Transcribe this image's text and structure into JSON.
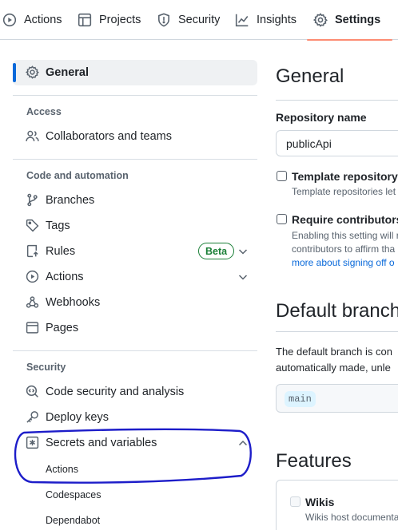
{
  "topnav": {
    "tabs": [
      {
        "label": "Actions",
        "icon": "play-circle-icon"
      },
      {
        "label": "Projects",
        "icon": "table-icon"
      },
      {
        "label": "Security",
        "icon": "shield-icon"
      },
      {
        "label": "Insights",
        "icon": "graph-icon"
      },
      {
        "label": "Settings",
        "icon": "gear-icon",
        "selected": true
      }
    ],
    "selected_underline_color": "#fd8c73"
  },
  "sidebar": {
    "general": "General",
    "sections": {
      "access": "Access",
      "code_automation": "Code and automation",
      "security": "Security"
    },
    "items": {
      "collaborators": "Collaborators and teams",
      "branches": "Branches",
      "tags": "Tags",
      "rules": "Rules",
      "rules_badge": "Beta",
      "actions": "Actions",
      "webhooks": "Webhooks",
      "pages": "Pages",
      "code_security": "Code security and analysis",
      "deploy_keys": "Deploy keys",
      "secrets": "Secrets and variables"
    },
    "secrets_sub": [
      "Actions",
      "Codespaces",
      "Dependabot"
    ],
    "accent_color": "#0969da",
    "annotation_color": "#1d1dc9"
  },
  "main": {
    "title": "General",
    "repo_name_label": "Repository name",
    "repo_name_value": "publicApi",
    "template_repo": {
      "title": "Template repository",
      "note": "Template repositories let"
    },
    "require_contributors": {
      "title": "Require contributors",
      "note_line1": "Enabling this setting will r",
      "note_line2": "contributors to affirm tha",
      "note_link": "more about signing off o"
    },
    "default_branch": {
      "title": "Default branch",
      "text_line1": "The default branch is con",
      "text_line2": "automatically made, unle",
      "branch": "main"
    },
    "features": {
      "title": "Features",
      "wikis_title": "Wikis",
      "wikis_note": "Wikis host documenta"
    }
  }
}
